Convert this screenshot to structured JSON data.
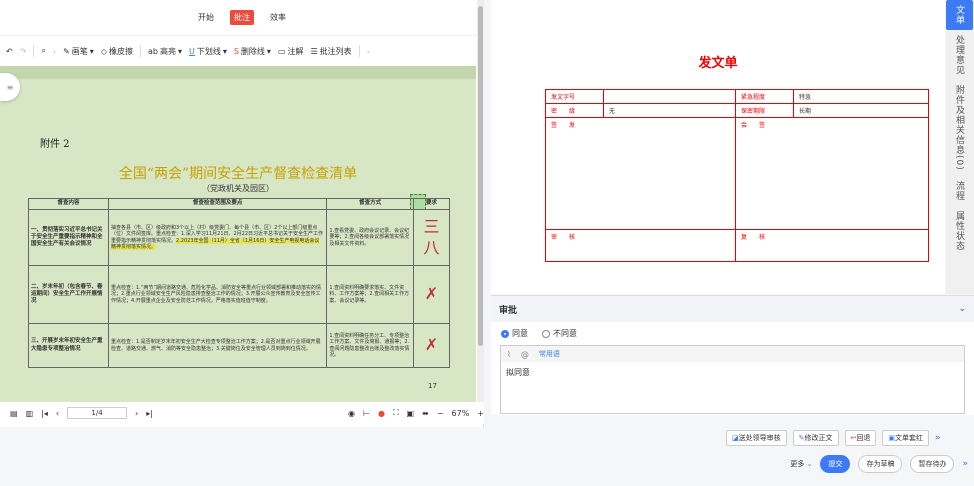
{
  "top_menu": {
    "items": [
      "开始",
      "批注",
      "效率"
    ],
    "active": "批注"
  },
  "toolbar": {
    "pen": "画笔",
    "eraser": "橡皮擦",
    "highlight": "高亮",
    "underline": "下划线",
    "strikethrough": "删除线",
    "comment": "注解",
    "comment_list": "批注列表"
  },
  "document": {
    "attachment": "附件 2",
    "title": "全国“两会”期间安全生产督查检查清单",
    "subtitle": "（党政机关及园区）",
    "table_headers": [
      "督查内容",
      "督查检查范围及要点",
      "督查方式",
      "要求"
    ],
    "rows": [
      {
        "name": "一、贯彻落实习近平总书记关于安全生产重要指示精神和全国安全生产有关会议情况",
        "points_a": "抽查各县（市、区）级政府和3个以上（村）级党委门、每个县（市、区）2个以上部门级重点（位）文件阅签库。重点检查：1.深入学习11月21日、2月22日习近平总书记关于安全生产工作重要指示精神贯彻落实情况。",
        "points_b": "2.2023年全国（11月）全省（1月16日）安全生产电视电话会议精神贯彻落实情况。",
        "method": "1.查看党委、政府会议记录、会议纪要等；2.查阅各级会议部署落实情况及相关文件资料。",
        "sign": "三八"
      },
      {
        "name": "二、岁末年初（包含春节、春运期间）安全生产工作开展情况",
        "points": "重点检查：1.“两节”期间道路交通、危险化学品、消防安全等重点行业领域部署和推动落实的情况；2.重点行业领域安全生产风险隐患排查整治工作的情况；3.开展公众宣传教育及安全宣传工作情况；4.开展重点企业及安全防范工作情况，严格落实值班值守制度。",
        "method": "1.查阅资料明确要求落实、文件资料、工作方案等；2.查阅相关工作方案、会议记录等。",
        "sign": "✗"
      },
      {
        "name": "三、开展岁末年初安全生产重大隐患专项整治情况",
        "points": "重点检查：1.是否制定岁末年初安全生产大检查专项整治工作方案；2.是否对重点行业领域开展检查、道路交通、燃气、消防等安全隐患整治；3.关键岗位及安全管理人员到岗到位情况。",
        "method": "1.查阅资料明确任务分工、专项整治工作方案、文件及简报、通报等；2.查阅问题隐患整改台账及整改落实情况。",
        "sign": "✗"
      }
    ],
    "page_number": "17"
  },
  "bottom_bar": {
    "page": "1/4",
    "zoom": "67%"
  },
  "form": {
    "title": "发文单",
    "rows": [
      {
        "l1": "发文字号",
        "v1": "",
        "l2": "紧急程度",
        "v2": "特急"
      },
      {
        "l1": "密　　级",
        "v1": "无",
        "l2": "保密期限",
        "v2": "长期"
      },
      {
        "l1": "签　　发",
        "v1": "",
        "l2": "会　　签",
        "v2": ""
      },
      {
        "l1": "审　　核",
        "v1": "",
        "l2": "复　　核",
        "v2": ""
      }
    ]
  },
  "right_tabs": [
    "文单",
    "处理意见",
    "附件及相关信息(0)",
    "流程",
    "属性状态"
  ],
  "approval": {
    "title": "审批",
    "agree": "同意",
    "disagree": "不同意",
    "common_phrases": "常用语",
    "opinion": "拟同意"
  },
  "actions": {
    "send_leader": "送处领导审核",
    "edit_text": "修改正文",
    "return": "回退",
    "red_head": "文单套红",
    "more": "更多",
    "submit": "提交",
    "save_draft": "存为草稿",
    "hold": "暂存待办"
  },
  "colors": {
    "accent": "#3d7bf5",
    "form_red": "#e00000",
    "doc_bg": "#d7e6c5",
    "active_menu": "#e74c3c"
  }
}
